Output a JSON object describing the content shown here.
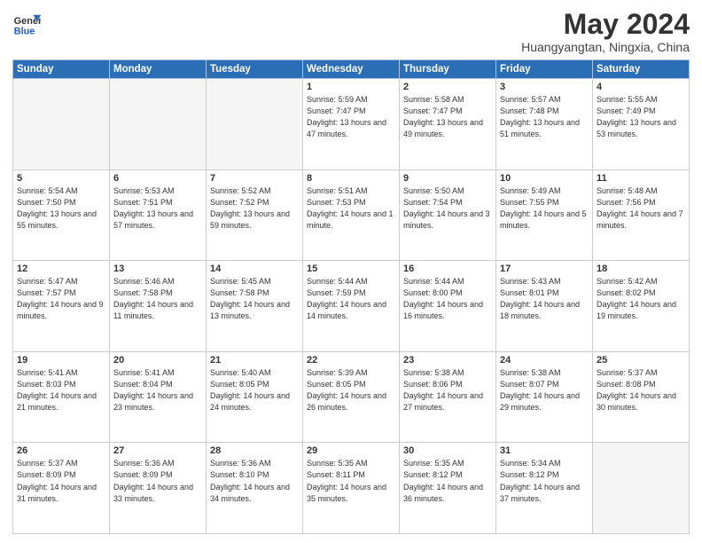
{
  "header": {
    "logo_general": "General",
    "logo_blue": "Blue",
    "title": "May 2024",
    "subtitle": "Huangyangtan, Ningxia, China"
  },
  "days_of_week": [
    "Sunday",
    "Monday",
    "Tuesday",
    "Wednesday",
    "Thursday",
    "Friday",
    "Saturday"
  ],
  "weeks": [
    [
      {
        "day": "",
        "empty": true
      },
      {
        "day": "",
        "empty": true
      },
      {
        "day": "",
        "empty": true
      },
      {
        "day": "1",
        "sunrise": "5:59 AM",
        "sunset": "7:47 PM",
        "daylight": "13 hours and 47 minutes."
      },
      {
        "day": "2",
        "sunrise": "5:58 AM",
        "sunset": "7:47 PM",
        "daylight": "13 hours and 49 minutes."
      },
      {
        "day": "3",
        "sunrise": "5:57 AM",
        "sunset": "7:48 PM",
        "daylight": "13 hours and 51 minutes."
      },
      {
        "day": "4",
        "sunrise": "5:55 AM",
        "sunset": "7:49 PM",
        "daylight": "13 hours and 53 minutes."
      }
    ],
    [
      {
        "day": "5",
        "sunrise": "5:54 AM",
        "sunset": "7:50 PM",
        "daylight": "13 hours and 55 minutes."
      },
      {
        "day": "6",
        "sunrise": "5:53 AM",
        "sunset": "7:51 PM",
        "daylight": "13 hours and 57 minutes."
      },
      {
        "day": "7",
        "sunrise": "5:52 AM",
        "sunset": "7:52 PM",
        "daylight": "13 hours and 59 minutes."
      },
      {
        "day": "8",
        "sunrise": "5:51 AM",
        "sunset": "7:53 PM",
        "daylight": "14 hours and 1 minute."
      },
      {
        "day": "9",
        "sunrise": "5:50 AM",
        "sunset": "7:54 PM",
        "daylight": "14 hours and 3 minutes."
      },
      {
        "day": "10",
        "sunrise": "5:49 AM",
        "sunset": "7:55 PM",
        "daylight": "14 hours and 5 minutes."
      },
      {
        "day": "11",
        "sunrise": "5:48 AM",
        "sunset": "7:56 PM",
        "daylight": "14 hours and 7 minutes."
      }
    ],
    [
      {
        "day": "12",
        "sunrise": "5:47 AM",
        "sunset": "7:57 PM",
        "daylight": "14 hours and 9 minutes."
      },
      {
        "day": "13",
        "sunrise": "5:46 AM",
        "sunset": "7:58 PM",
        "daylight": "14 hours and 11 minutes."
      },
      {
        "day": "14",
        "sunrise": "5:45 AM",
        "sunset": "7:58 PM",
        "daylight": "14 hours and 13 minutes."
      },
      {
        "day": "15",
        "sunrise": "5:44 AM",
        "sunset": "7:59 PM",
        "daylight": "14 hours and 14 minutes."
      },
      {
        "day": "16",
        "sunrise": "5:44 AM",
        "sunset": "8:00 PM",
        "daylight": "14 hours and 16 minutes."
      },
      {
        "day": "17",
        "sunrise": "5:43 AM",
        "sunset": "8:01 PM",
        "daylight": "14 hours and 18 minutes."
      },
      {
        "day": "18",
        "sunrise": "5:42 AM",
        "sunset": "8:02 PM",
        "daylight": "14 hours and 19 minutes."
      }
    ],
    [
      {
        "day": "19",
        "sunrise": "5:41 AM",
        "sunset": "8:03 PM",
        "daylight": "14 hours and 21 minutes."
      },
      {
        "day": "20",
        "sunrise": "5:41 AM",
        "sunset": "8:04 PM",
        "daylight": "14 hours and 23 minutes."
      },
      {
        "day": "21",
        "sunrise": "5:40 AM",
        "sunset": "8:05 PM",
        "daylight": "14 hours and 24 minutes."
      },
      {
        "day": "22",
        "sunrise": "5:39 AM",
        "sunset": "8:05 PM",
        "daylight": "14 hours and 26 minutes."
      },
      {
        "day": "23",
        "sunrise": "5:38 AM",
        "sunset": "8:06 PM",
        "daylight": "14 hours and 27 minutes."
      },
      {
        "day": "24",
        "sunrise": "5:38 AM",
        "sunset": "8:07 PM",
        "daylight": "14 hours and 29 minutes."
      },
      {
        "day": "25",
        "sunrise": "5:37 AM",
        "sunset": "8:08 PM",
        "daylight": "14 hours and 30 minutes."
      }
    ],
    [
      {
        "day": "26",
        "sunrise": "5:37 AM",
        "sunset": "8:09 PM",
        "daylight": "14 hours and 31 minutes."
      },
      {
        "day": "27",
        "sunrise": "5:36 AM",
        "sunset": "8:09 PM",
        "daylight": "14 hours and 33 minutes."
      },
      {
        "day": "28",
        "sunrise": "5:36 AM",
        "sunset": "8:10 PM",
        "daylight": "14 hours and 34 minutes."
      },
      {
        "day": "29",
        "sunrise": "5:35 AM",
        "sunset": "8:11 PM",
        "daylight": "14 hours and 35 minutes."
      },
      {
        "day": "30",
        "sunrise": "5:35 AM",
        "sunset": "8:12 PM",
        "daylight": "14 hours and 36 minutes."
      },
      {
        "day": "31",
        "sunrise": "5:34 AM",
        "sunset": "8:12 PM",
        "daylight": "14 hours and 37 minutes."
      },
      {
        "day": "",
        "empty": true
      }
    ]
  ]
}
